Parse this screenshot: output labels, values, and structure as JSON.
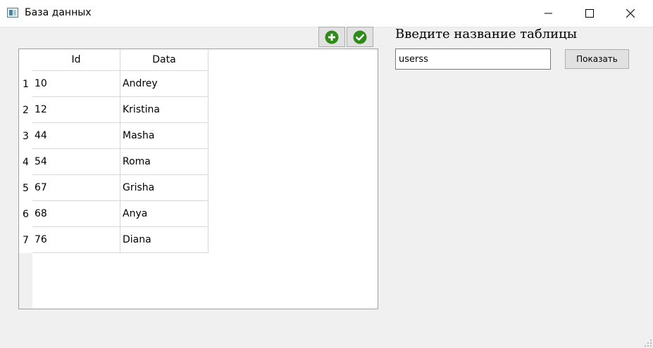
{
  "window": {
    "title": "База данных",
    "icon": "database-app-icon"
  },
  "toolbar": {
    "add_icon": "plus-circle-icon",
    "confirm_icon": "check-circle-icon",
    "icon_color": "#2e8b1a"
  },
  "table": {
    "columns": [
      "Id",
      "Data"
    ],
    "row_numbers": [
      "1",
      "2",
      "3",
      "4",
      "5",
      "6",
      "7"
    ],
    "rows": [
      [
        "10",
        "Andrey"
      ],
      [
        "12",
        "Kristina"
      ],
      [
        "44",
        "Masha"
      ],
      [
        "54",
        "Roma"
      ],
      [
        "67",
        "Grisha"
      ],
      [
        "68",
        "Anya"
      ],
      [
        "76",
        "Diana"
      ]
    ]
  },
  "form": {
    "prompt": "Введите название таблицы",
    "table_name_value": "userss",
    "show_button_label": "Показать"
  }
}
